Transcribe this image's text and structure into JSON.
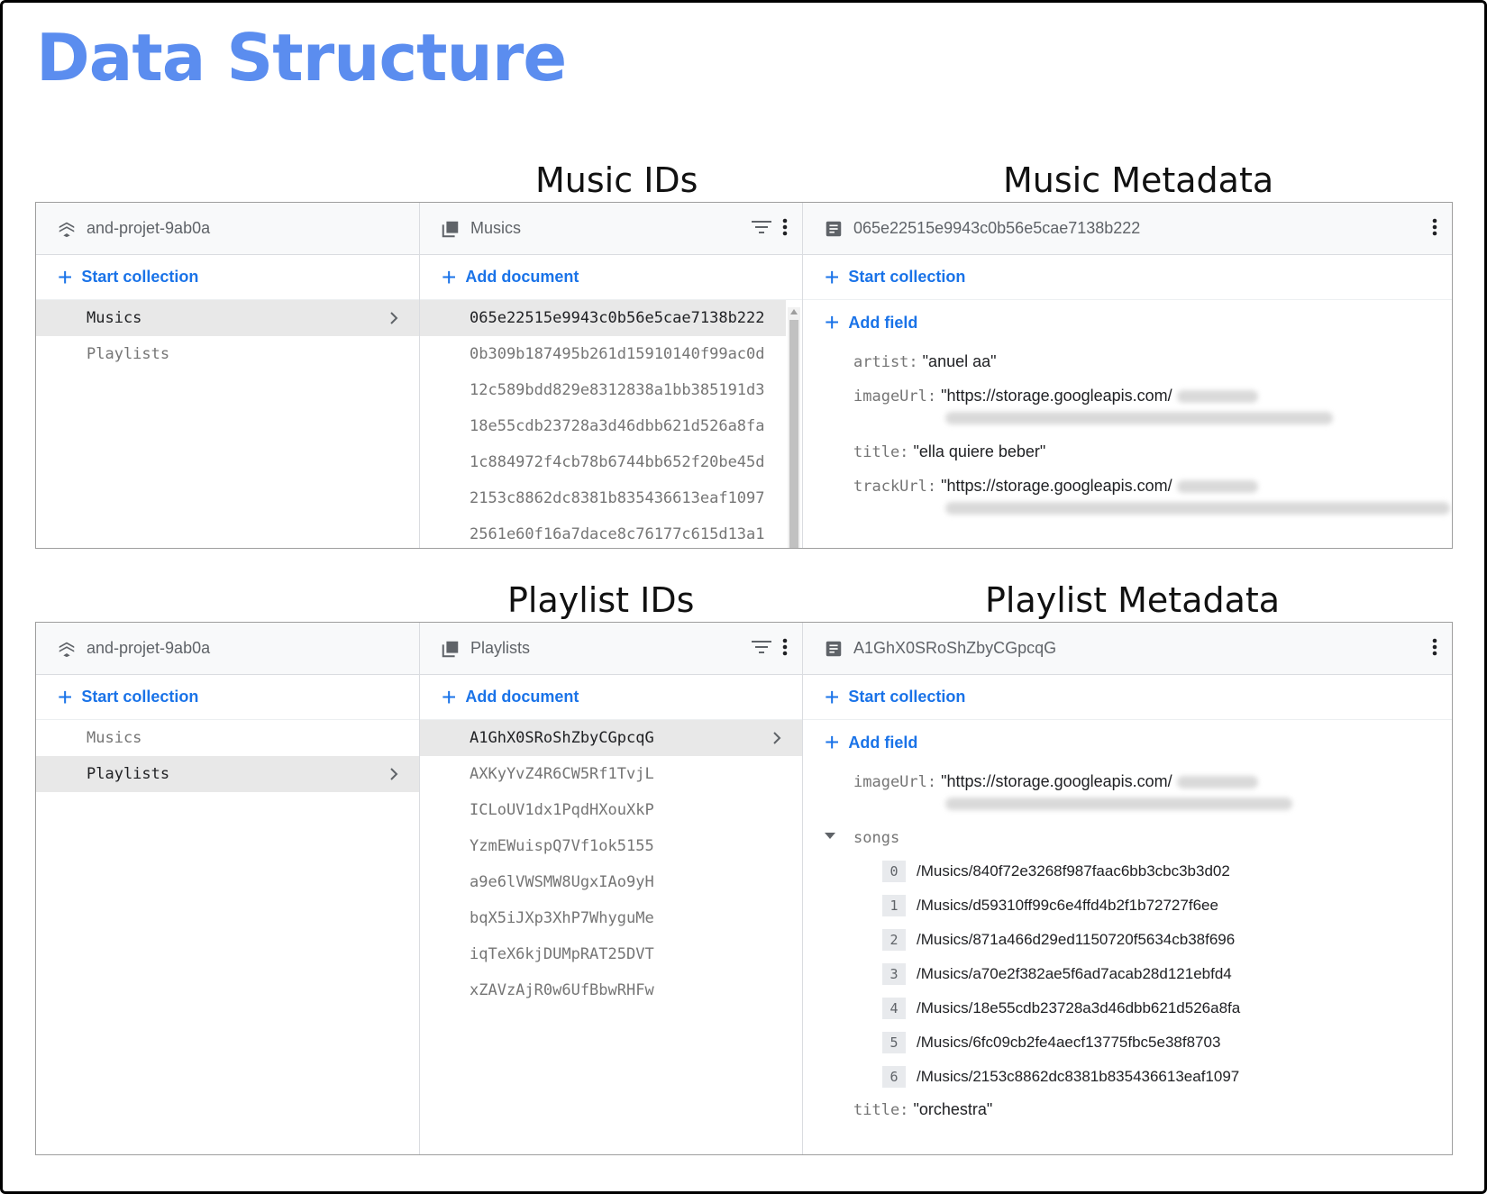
{
  "title": "Data Structure",
  "labels": {
    "music_ids": "Music IDs",
    "music_metadata": "Music Metadata",
    "playlist_ids": "Playlist IDs",
    "playlist_metadata": "Playlist Metadata"
  },
  "panel1": {
    "root": {
      "header": "and-projet-9ab0a",
      "start_collection": "Start collection",
      "collections": [
        "Musics",
        "Playlists"
      ],
      "selected": "Musics"
    },
    "collection": {
      "header": "Musics",
      "add_document": "Add document",
      "documents": [
        "065e22515e9943c0b56e5cae7138b222",
        "0b309b187495b261d15910140f99ac0d",
        "12c589bdd829e8312838a1bb385191d3",
        "18e55cdb23728a3d46dbb621d526a8fa",
        "1c884972f4cb78b6744bb652f20be45d",
        "2153c8862dc8381b835436613eaf1097",
        "2561e60f16a7dace8c76177c615d13a1"
      ]
    },
    "document": {
      "header": "065e22515e9943c0b56e5cae7138b222",
      "start_collection": "Start collection",
      "add_field": "Add field",
      "fields": {
        "artist_key": "artist:",
        "artist_val": "\"anuel aa\"",
        "imageUrl_key": "imageUrl:",
        "imageUrl_val": "\"https://storage.googleapis.com/",
        "title_key": "title:",
        "title_val": "\"ella quiere beber\"",
        "trackUrl_key": "trackUrl:",
        "trackUrl_val": "\"https://storage.googleapis.com/"
      }
    }
  },
  "panel2": {
    "root": {
      "header": "and-projet-9ab0a",
      "start_collection": "Start collection",
      "collections": [
        "Musics",
        "Playlists"
      ],
      "selected": "Playlists"
    },
    "collection": {
      "header": "Playlists",
      "add_document": "Add document",
      "documents": [
        "A1GhX0SRoShZbyCGpcqG",
        "AXKyYvZ4R6CW5Rf1TvjL",
        "ICLoUV1dx1PqdHXouXkP",
        "YzmEWuispQ7Vf1ok5155",
        "a9e6lVWSMW8UgxIAo9yH",
        "bqX5iJXp3XhP7WhyguMe",
        "iqTeX6kjDUMpRAT25DVT",
        "xZAVzAjR0w6UfBbwRHFw"
      ]
    },
    "document": {
      "header": "A1GhX0SRoShZbyCGpcqG",
      "start_collection": "Start collection",
      "add_field": "Add field",
      "imageUrl_key": "imageUrl:",
      "imageUrl_val": "\"https://storage.googleapis.com/",
      "songs_key": "songs",
      "songs": [
        {
          "idx": "0",
          "path": "/Musics/840f72e3268f987faac6bb3cbc3b3d02"
        },
        {
          "idx": "1",
          "path": "/Musics/d59310ff99c6e4ffd4b2f1b72727f6ee"
        },
        {
          "idx": "2",
          "path": "/Musics/871a466d29ed1150720f5634cb38f696"
        },
        {
          "idx": "3",
          "path": "/Musics/a70e2f382ae5f6ad7acab28d121ebfd4"
        },
        {
          "idx": "4",
          "path": "/Musics/18e55cdb23728a3d46dbb621d526a8fa"
        },
        {
          "idx": "5",
          "path": "/Musics/6fc09cb2fe4aecf13775fbc5e38f8703"
        },
        {
          "idx": "6",
          "path": "/Musics/2153c8862dc8381b835436613eaf1097"
        }
      ],
      "title_key": "title:",
      "title_val": "\"orchestra\""
    }
  },
  "icons": {
    "root": "firestore-icon",
    "collection": "collection-icon",
    "document": "document-icon",
    "filter": "filter-icon",
    "more": "more-vert-icon",
    "chevron": "chevron-right-icon"
  },
  "colors": {
    "title": "#5b8def",
    "accent": "#1a73e8",
    "selected_row": "#e8e8e8"
  }
}
